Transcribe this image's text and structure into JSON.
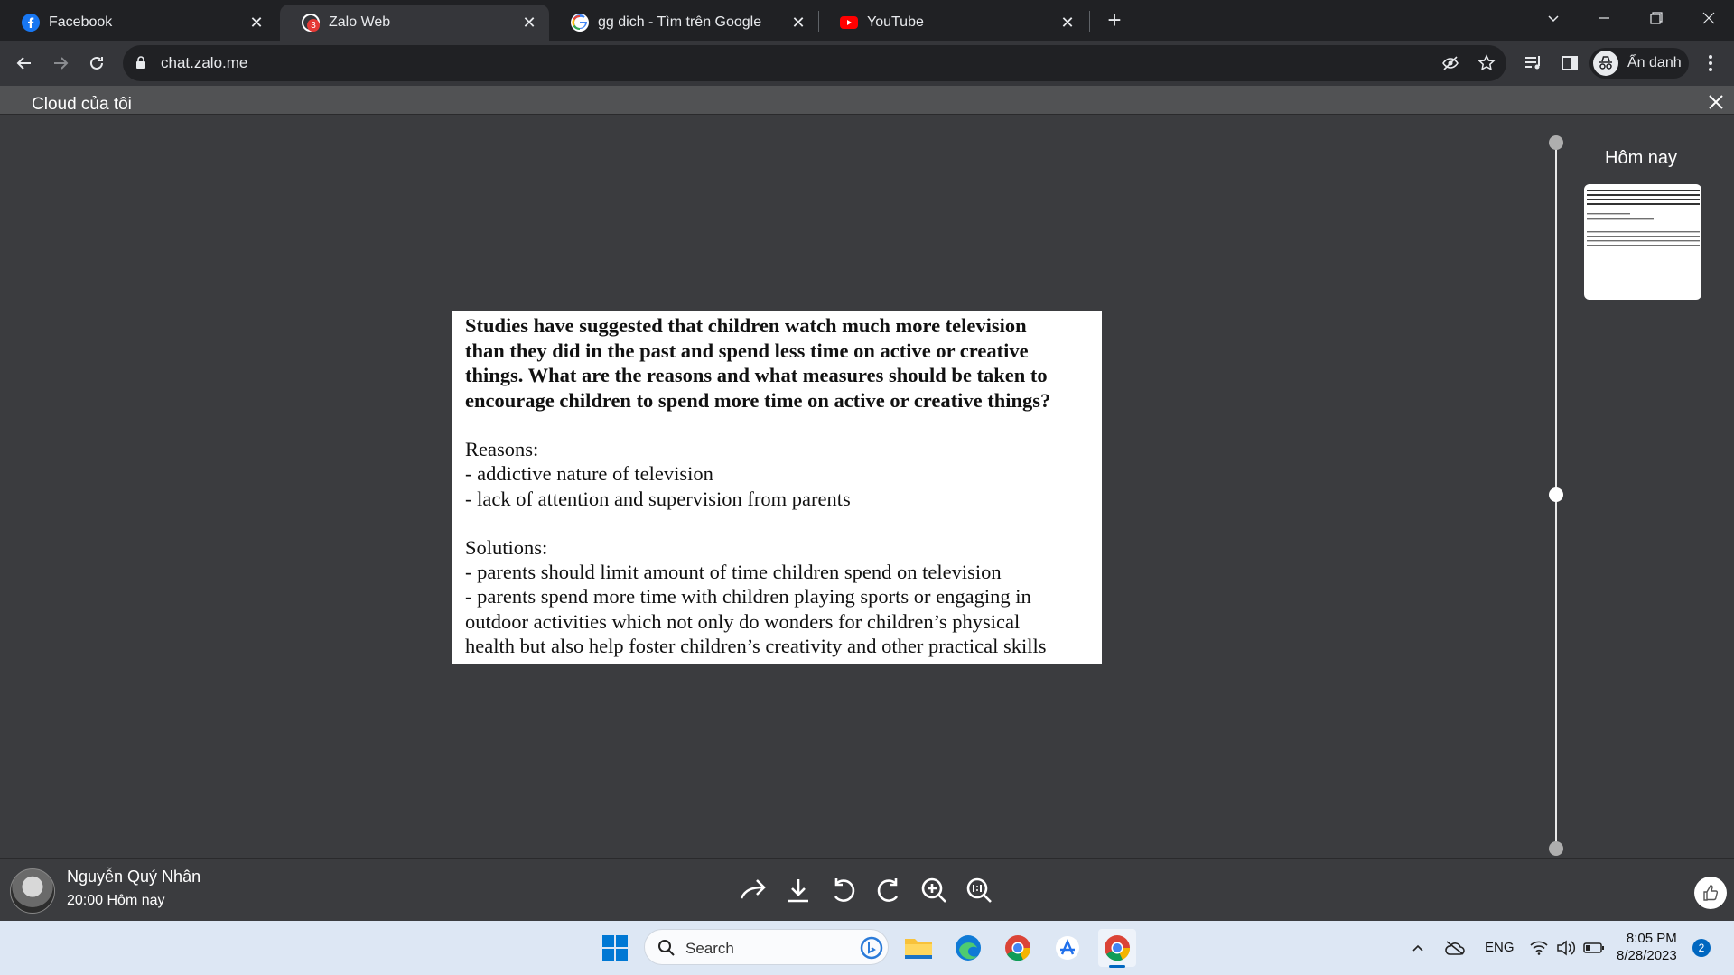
{
  "browser": {
    "tabs": [
      {
        "title": "Facebook",
        "icon": "facebook-icon"
      },
      {
        "title": "Zalo Web",
        "icon": "zalo-icon",
        "badge": "3"
      },
      {
        "title": "gg dich - Tìm trên Google",
        "icon": "google-icon"
      },
      {
        "title": "YouTube",
        "icon": "youtube-icon"
      }
    ],
    "active_tab": 1,
    "url": "chat.zalo.me",
    "profile_label": "Ẩn danh"
  },
  "viewer": {
    "title": "Cloud của tôi",
    "date_group": "Hôm nay",
    "document": {
      "question": "Studies have suggested that children watch much more television than they did in the past and spend less time on active or creative things. What are the reasons and what measures should be taken to encourage children to spend more time on active or creative things?",
      "question_lines": [
        "Studies have suggested that children watch much more television",
        "than they did in the past and spend less time on active or creative",
        "things. What are the reasons and what measures should be taken to",
        "encourage children to spend more time on active or creative things?"
      ],
      "reasons_heading": "Reasons:",
      "reasons": [
        "- addictive nature of television",
        "- lack of attention and supervision from parents"
      ],
      "solutions_heading": "Solutions:",
      "solutions": [
        "- parents should limit amount of time children spend on television",
        "- parents spend more time with children playing sports or engaging in",
        "outdoor activities which not only do wonders for children’s physical",
        "health but also help foster children’s creativity and other practical skills"
      ]
    },
    "sender": {
      "name": "Nguyễn Quý Nhân",
      "time": "20:00 Hôm nay"
    },
    "tools": [
      "share-forward-icon",
      "download-icon",
      "rotate-left-icon",
      "rotate-right-icon",
      "zoom-in-icon",
      "actual-size-icon"
    ]
  },
  "taskbar": {
    "search_label": "Search",
    "language": "ENG",
    "time": "8:05 PM",
    "date": "8/28/2023",
    "notification_count": "2"
  },
  "colors": {
    "viewer_bg": "#3b3c3f",
    "chrome_dark": "#202124",
    "chrome_toolbar": "#35363a",
    "taskbar_bg": "#dde7f4"
  }
}
